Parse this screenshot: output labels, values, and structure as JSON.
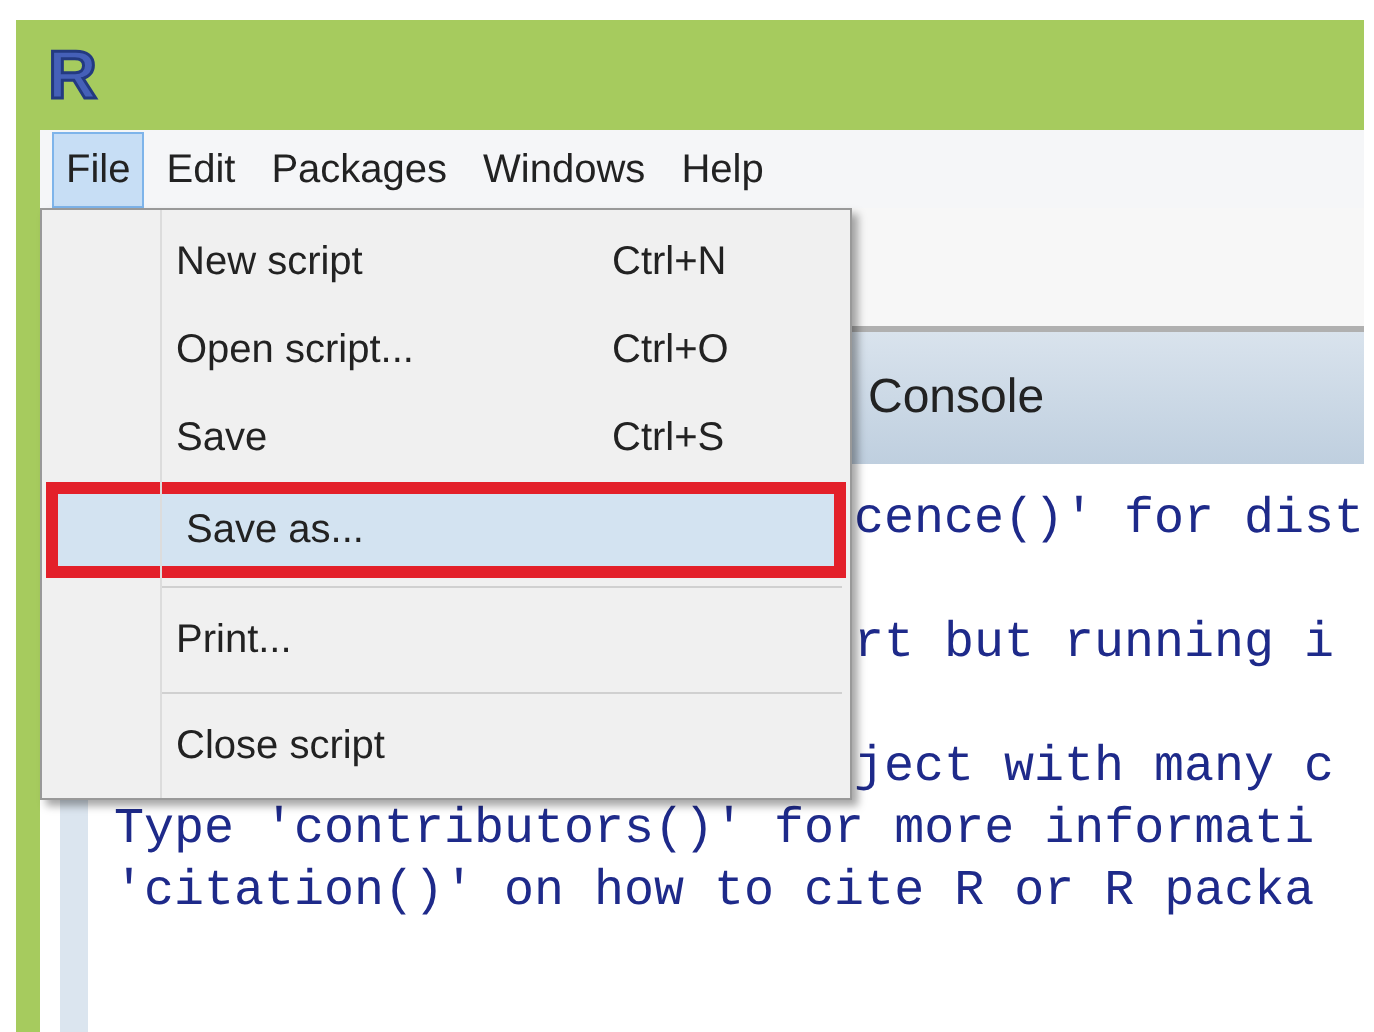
{
  "window": {
    "logo": "R"
  },
  "menu_bar": [
    {
      "label": "File",
      "selected": true
    },
    {
      "label": "Edit",
      "selected": false
    },
    {
      "label": "Packages",
      "selected": false
    },
    {
      "label": "Windows",
      "selected": false
    },
    {
      "label": "Help",
      "selected": false
    }
  ],
  "file_menu": [
    {
      "kind": "item",
      "label": "New script",
      "shortcut": "Ctrl+N",
      "selected": false
    },
    {
      "kind": "item",
      "label": "Open script...",
      "shortcut": "Ctrl+O",
      "selected": false
    },
    {
      "kind": "item",
      "label": "Save",
      "shortcut": "Ctrl+S",
      "selected": false
    },
    {
      "kind": "item",
      "label": "Save as...",
      "selected": true
    },
    {
      "kind": "separator"
    },
    {
      "kind": "item",
      "label": "Print...",
      "selected": false
    },
    {
      "kind": "separator"
    },
    {
      "kind": "item",
      "label": "Close script",
      "selected": false
    }
  ],
  "console": {
    "title": "Console",
    "lines": [
      {
        "kind": "partial",
        "text": "cence()' for dist"
      },
      {
        "kind": "blank"
      },
      {
        "kind": "partial",
        "text": "rt but running i"
      },
      {
        "kind": "blank"
      },
      {
        "kind": "partial",
        "text": "ject with many c"
      },
      {
        "kind": "full",
        "text": "Type 'contributors()' for more informati"
      },
      {
        "kind": "full",
        "text": "'citation()' on how to cite R or R packa"
      }
    ]
  }
}
